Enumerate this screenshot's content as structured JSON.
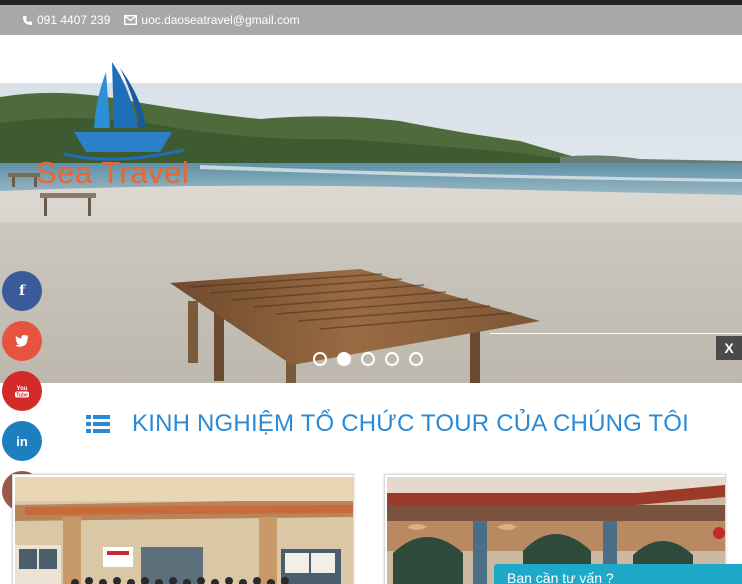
{
  "topbar": {
    "phone": "091 4407 239",
    "email": "uoc.daoseatravel@gmail.com"
  },
  "logo": {
    "text": "Sea Travel"
  },
  "hero": {
    "close_label": "X",
    "slides_total": 5,
    "active_slide": 2
  },
  "social": [
    {
      "name": "facebook",
      "glyph": "f"
    },
    {
      "name": "twitter",
      "glyph": "t"
    },
    {
      "name": "youtube",
      "glyph": "You"
    },
    {
      "name": "linkedin",
      "glyph": "in"
    },
    {
      "name": "instagram",
      "glyph": "◎"
    }
  ],
  "section": {
    "title": "KINH NGHIỆM TỔ CHỨC TOUR CỦA CHÚNG TÔI"
  },
  "chat": {
    "label": "Bạn cần tư vấn ?"
  },
  "colors": {
    "accent_blue": "#2b8ad6",
    "topbar_gray": "#a8a8a8",
    "logo_orange": "#f0642d",
    "chat_cyan": "#1ea9c9"
  }
}
